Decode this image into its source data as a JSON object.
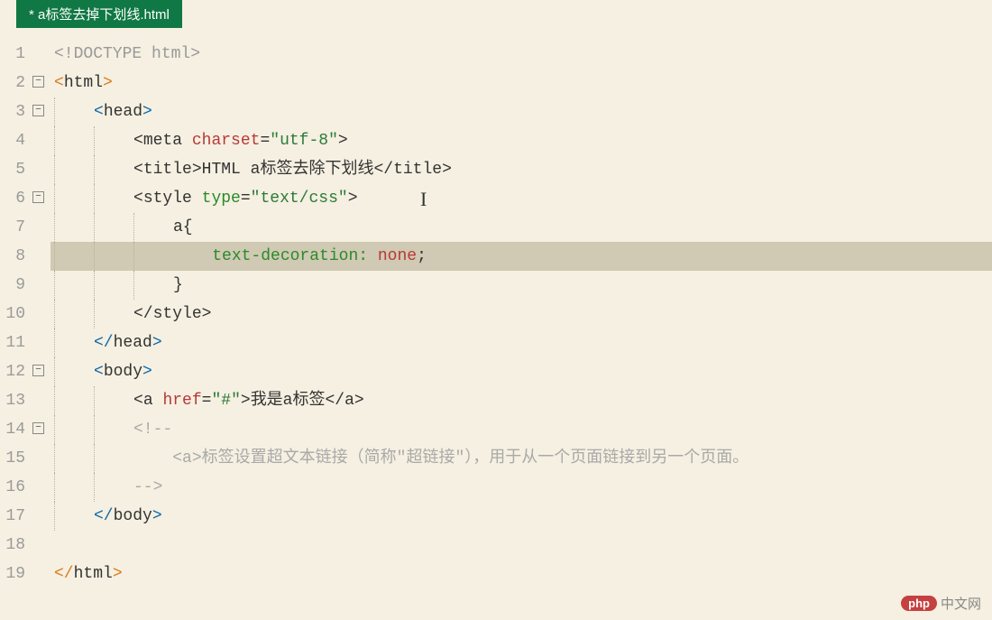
{
  "tab": {
    "title": " * a标签去掉下划线.html"
  },
  "lines": {
    "n1": "1",
    "n2": "2",
    "n3": "3",
    "n4": "4",
    "n5": "5",
    "n6": "6",
    "n7": "7",
    "n8": "8",
    "n9": "9",
    "n10": "10",
    "n11": "11",
    "n12": "12",
    "n13": "13",
    "n14": "14",
    "n15": "15",
    "n16": "16",
    "n17": "17",
    "n18": "18",
    "n19": "19"
  },
  "code": {
    "doctype": "<!DOCTYPE html>",
    "html_open_l": "<",
    "html_tag": "html",
    "html_open_r": ">",
    "head_open_l": "<",
    "head_tag": "head",
    "head_open_r": ">",
    "meta_l": "<",
    "meta_tag": "meta",
    "meta_attr": "charset",
    "meta_eq": "=",
    "meta_val": "\"utf-8\"",
    "meta_r": ">",
    "title_l": "<",
    "title_tag": "title",
    "title_r": ">",
    "title_text": "HTML a标签去除下划线",
    "title_cl": "</",
    "title_cr": ">",
    "style_l": "<",
    "style_tag": "style",
    "style_attr": "type",
    "style_eq": "=",
    "style_val": "\"text/css\"",
    "style_r": ">",
    "css_sel": "a{",
    "css_prop": "text-decoration:",
    "css_val": " none",
    "css_semi": ";",
    "css_close": "}",
    "style_cl": "</",
    "style_cr": ">",
    "head_cl": "</",
    "head_cr": ">",
    "body_l": "<",
    "body_tag": "body",
    "body_r": ">",
    "a_l": "<",
    "a_tag": "a",
    "a_attr": "href",
    "a_eq": "=",
    "a_val": "\"#\"",
    "a_r": ">",
    "a_text": "我是a标签",
    "a_cl": "</",
    "a_cr": ">",
    "cmt_open": "<!--",
    "cmt_tag_l": "<",
    "cmt_tag": "a",
    "cmt_tag_r": ">",
    "cmt_text": "标签设置超文本链接（简称\"超链接\"），用于从一个页面链接到另一个页面。",
    "cmt_close": "-->",
    "body_cl": "</",
    "body_cr": ">",
    "html_cl": "</",
    "html_cr": ">"
  },
  "fold": {
    "minus": "−"
  },
  "watermark": {
    "badge": "php",
    "text": "中文网"
  }
}
